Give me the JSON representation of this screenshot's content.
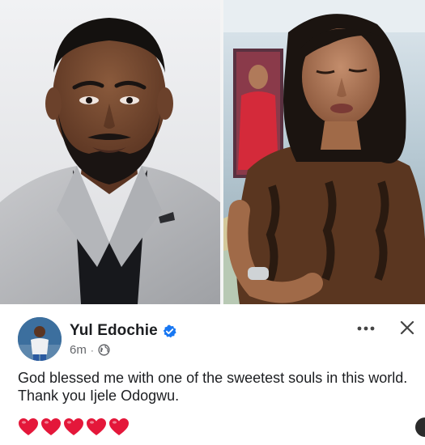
{
  "post": {
    "author_name": "Yul Edochie",
    "verified_icon": "verified-badge-icon",
    "timestamp": "6m",
    "separator": "·",
    "privacy_icon": "globe-icon",
    "more_icon": "more-horizontal-icon",
    "close_icon": "close-icon",
    "body_line_1": "God blessed me with one of the sweetest souls in this world.",
    "body_line_2": "Thank you Ijele Odogwu.",
    "heart_count": 5,
    "heart_icon": "red-heart-icon"
  },
  "colors": {
    "accent_blue": "#1877f2",
    "text_primary": "#1c1e21",
    "text_secondary": "#65676b",
    "heart_red": "#e4173a"
  }
}
